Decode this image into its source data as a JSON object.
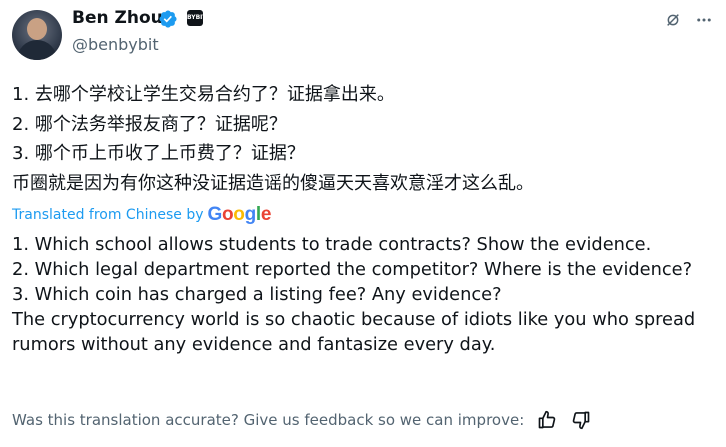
{
  "author": {
    "name": "Ben Zhou",
    "handle": "@benbybit",
    "affiliate_badge": "BYBIT"
  },
  "original": {
    "lines": [
      "1. 去哪个学校让学生交易合约了？证据拿出来。",
      "2. 哪个法务举报友商了？证据呢？",
      "3. 哪个币上币收了上币费了？证据？",
      "币圈就是因为有你这种没证据造谣的傻逼天天喜欢意淫才这么乱。"
    ]
  },
  "translation": {
    "label": "Translated from Chinese by",
    "provider": "Google",
    "lines": [
      "1. Which school allows students to trade contracts? Show the evidence.",
      "2. Which legal department reported the competitor? Where is the evidence?",
      "3. Which coin has charged a listing fee? Any evidence?",
      "The cryptocurrency world is so chaotic because of idiots like you who spread rumors without any evidence and fantasize every day."
    ]
  },
  "feedback": {
    "prompt": "Was this translation accurate? Give us feedback so we can improve:"
  },
  "colors": {
    "link": "#1d9bf0",
    "secondary_text": "#536471",
    "primary_text": "#0f1419",
    "google_blue": "#4285F4",
    "google_red": "#EA4335",
    "google_yellow": "#FBBC05",
    "google_green": "#34A853"
  },
  "icons": [
    "verified-badge-icon",
    "grok-icon",
    "more-options-icon",
    "thumbs-up-icon",
    "thumbs-down-icon"
  ]
}
